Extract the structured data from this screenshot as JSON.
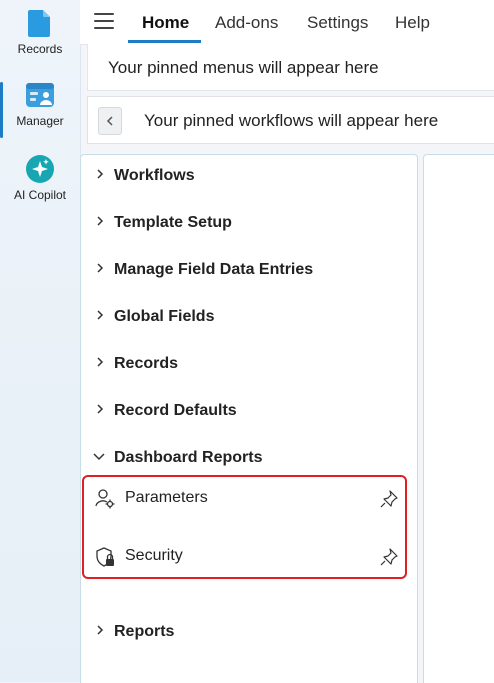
{
  "rail": {
    "items": [
      {
        "label": "Records",
        "icon": "records-icon",
        "color": "#2196d8"
      },
      {
        "label": "Manager",
        "icon": "manager-icon",
        "color": "#2196d8"
      },
      {
        "label": "AI Copilot",
        "icon": "ai-copilot-icon",
        "color": "#13a7b0"
      }
    ],
    "active": "Manager"
  },
  "topbar": {
    "tabs": [
      {
        "label": "Home"
      },
      {
        "label": "Add-ons"
      },
      {
        "label": "Settings"
      },
      {
        "label": "Help"
      }
    ],
    "active_tab": "Home",
    "accent": "#1e7cc4"
  },
  "pinned": {
    "menus_text": "Your pinned menus will appear here",
    "workflows_text": "Your pinned workflows will appear here"
  },
  "tree": {
    "items": [
      {
        "label": "Workflows",
        "expanded": false
      },
      {
        "label": "Template Setup",
        "expanded": false
      },
      {
        "label": "Manage Field Data Entries",
        "expanded": false
      },
      {
        "label": "Global Fields",
        "expanded": false
      },
      {
        "label": "Records",
        "expanded": false
      },
      {
        "label": "Record Defaults",
        "expanded": false
      },
      {
        "label": "Dashboard Reports",
        "expanded": true
      },
      {
        "label": "Reports",
        "expanded": false
      }
    ],
    "dashboard_children": [
      {
        "label": "Parameters",
        "icon": "user-gear-icon"
      },
      {
        "label": "Security",
        "icon": "shield-lock-icon"
      }
    ]
  },
  "highlight_color": "#e02020"
}
